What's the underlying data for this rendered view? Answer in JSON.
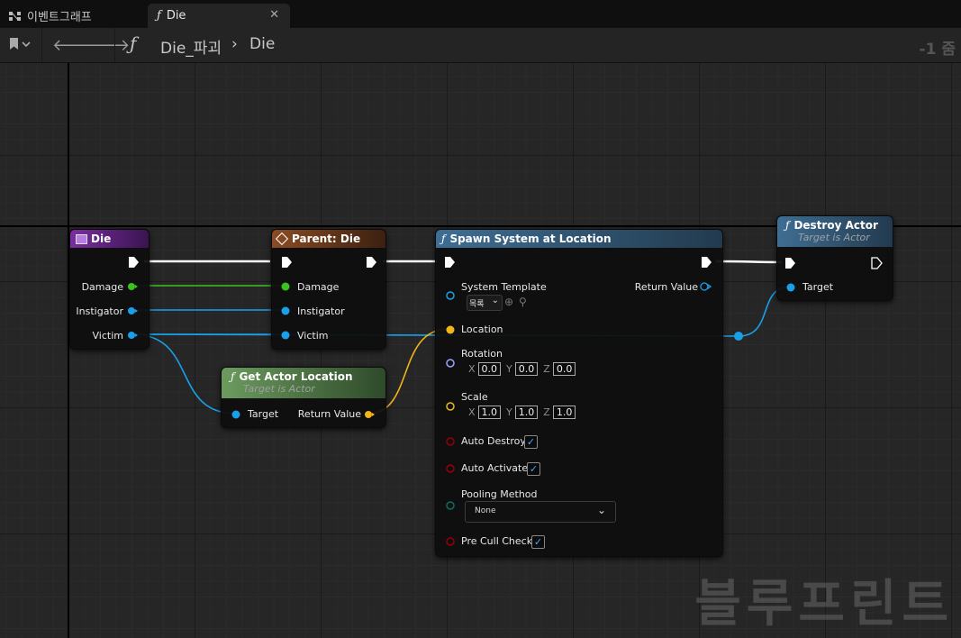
{
  "tabs": [
    {
      "label": "이벤트그래프",
      "active": false,
      "icon": "event-graph-icon"
    },
    {
      "label": "Die",
      "active": true,
      "icon": "function-icon"
    }
  ],
  "toolbar": {
    "breadcrumb": [
      "Die_파괴",
      "Die"
    ],
    "zoom": "-1 줌"
  },
  "nodes": {
    "die": {
      "title": "Die",
      "pins": [
        "Damage",
        "Instigator",
        "Victim"
      ]
    },
    "parent": {
      "title": "Parent: Die",
      "pins": [
        "Damage",
        "Instigator",
        "Victim"
      ]
    },
    "get_location": {
      "title": "Get Actor Location",
      "subtitle": "Target is Actor",
      "in": "Target",
      "out": "Return Value"
    },
    "spawn": {
      "title": "Spawn System at Location",
      "system_template": "System Template",
      "asset_value": "목록",
      "return_value": "Return Value",
      "location": "Location",
      "rotation": "Rotation",
      "rotation_xyz": [
        "0.0",
        "0.0",
        "0.0"
      ],
      "scale": "Scale",
      "scale_xyz": [
        "1.0",
        "1.0",
        "1.0"
      ],
      "auto_destroy": "Auto Destroy",
      "auto_activate": "Auto Activate",
      "pooling_method": "Pooling Method",
      "pooling_value": "None",
      "pre_cull_check": "Pre Cull Check",
      "axis_labels": [
        "X",
        "Y",
        "Z"
      ]
    },
    "destroy": {
      "title": "Destroy Actor",
      "subtitle": "Target is Actor",
      "in": "Target"
    }
  },
  "watermark": "블루프린트",
  "colors": {
    "exec": "#ffffff",
    "float_pin": "#39c31f",
    "object_pin": "#1aa0e8",
    "vector_pin": "#f0b61c",
    "rotator_pin": "#9aa6ff",
    "bool_pin": "#950000",
    "enum_pin": "#0c6d5e",
    "event_header": "#7a2ea0",
    "parent_header": "#8a4c24",
    "pure_header": "#6c9b5f",
    "function_header": "#3f6e93"
  }
}
